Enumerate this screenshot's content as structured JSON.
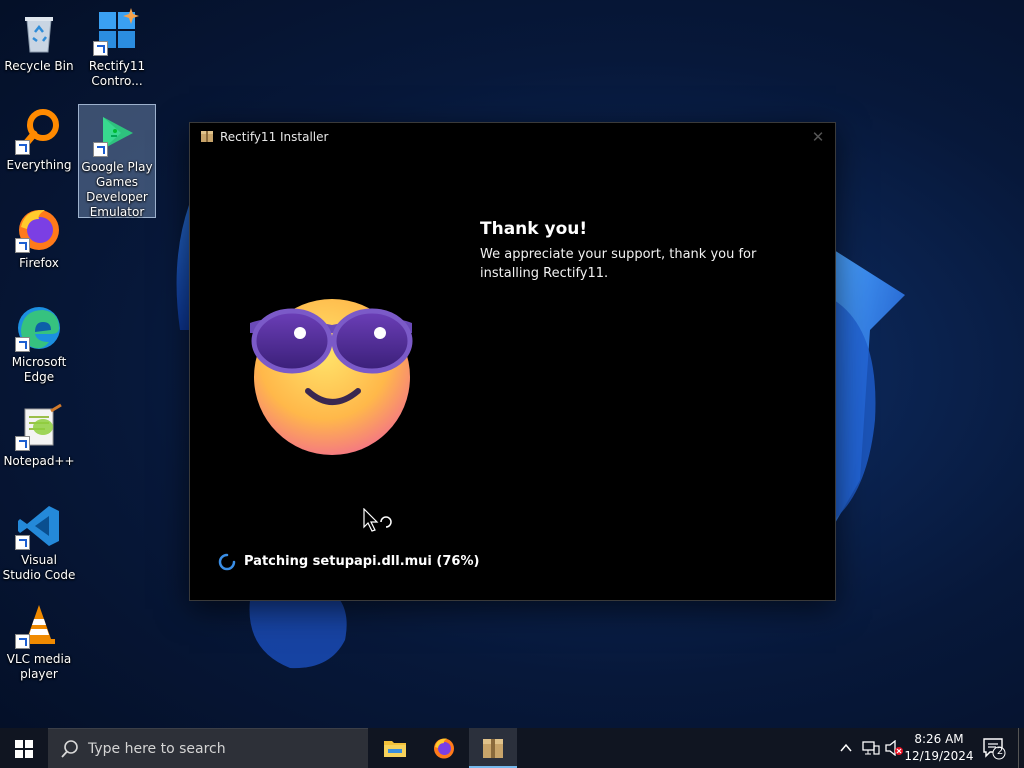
{
  "desktop": {
    "icons": [
      {
        "label": "Recycle Bin"
      },
      {
        "label": "Rectify11 Contro..."
      },
      {
        "label": "Everything"
      },
      {
        "label": "Google Play Games Developer Emulator"
      },
      {
        "label": "Firefox"
      },
      {
        "label": "Microsoft Edge"
      },
      {
        "label": "Notepad++"
      },
      {
        "label": "Visual Studio Code"
      },
      {
        "label": "VLC media player"
      }
    ]
  },
  "installer": {
    "title": "Rectify11 Installer",
    "heading": "Thank you!",
    "message": "We appreciate your support, thank you for installing Rectify11.",
    "status": "Patching setupapi.dll.mui (76%)",
    "progress_percent": 76
  },
  "taskbar": {
    "search_placeholder": "Type here to search",
    "apps": [
      "file-explorer",
      "firefox",
      "rectify11-installer"
    ],
    "time": "8:26 AM",
    "date": "12/19/2024",
    "notification_count": "2"
  },
  "colors": {
    "accent": "#76b9ed",
    "window_bg": "#000000",
    "taskbar_bg": "#101521"
  }
}
